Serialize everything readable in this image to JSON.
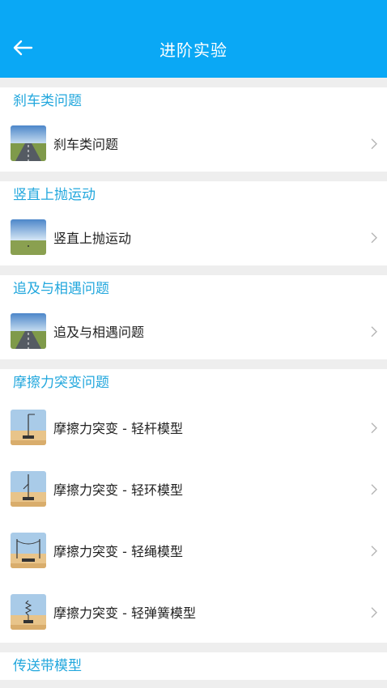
{
  "header": {
    "title": "进阶实验",
    "back_icon": "back-arrow-icon"
  },
  "sections": [
    {
      "title": "刹车类问题",
      "items": [
        {
          "label": "刹车类问题",
          "thumb": "road-scene-icon"
        }
      ]
    },
    {
      "title": "竖直上抛运动",
      "items": [
        {
          "label": "竖直上抛运动",
          "thumb": "sky-ground-scene-icon"
        }
      ]
    },
    {
      "title": "追及与相遇问题",
      "items": [
        {
          "label": "追及与相遇问题",
          "thumb": "road-scene-icon"
        }
      ]
    },
    {
      "title": "摩擦力突变问题",
      "items": [
        {
          "label": "摩擦力突变 - 轻杆模型",
          "thumb": "light-rod-model-icon"
        },
        {
          "label": "摩擦力突变 - 轻环模型",
          "thumb": "light-ring-model-icon"
        },
        {
          "label": "摩擦力突变 - 轻绳模型",
          "thumb": "light-rope-model-icon"
        },
        {
          "label": "摩擦力突变 - 轻弹簧模型",
          "thumb": "light-spring-model-icon"
        }
      ]
    },
    {
      "title": "传送带模型",
      "items": []
    }
  ],
  "colors": {
    "header_bg": "#0aa8f5",
    "section_title": "#22a7dd",
    "page_bg": "#eeeeee"
  }
}
